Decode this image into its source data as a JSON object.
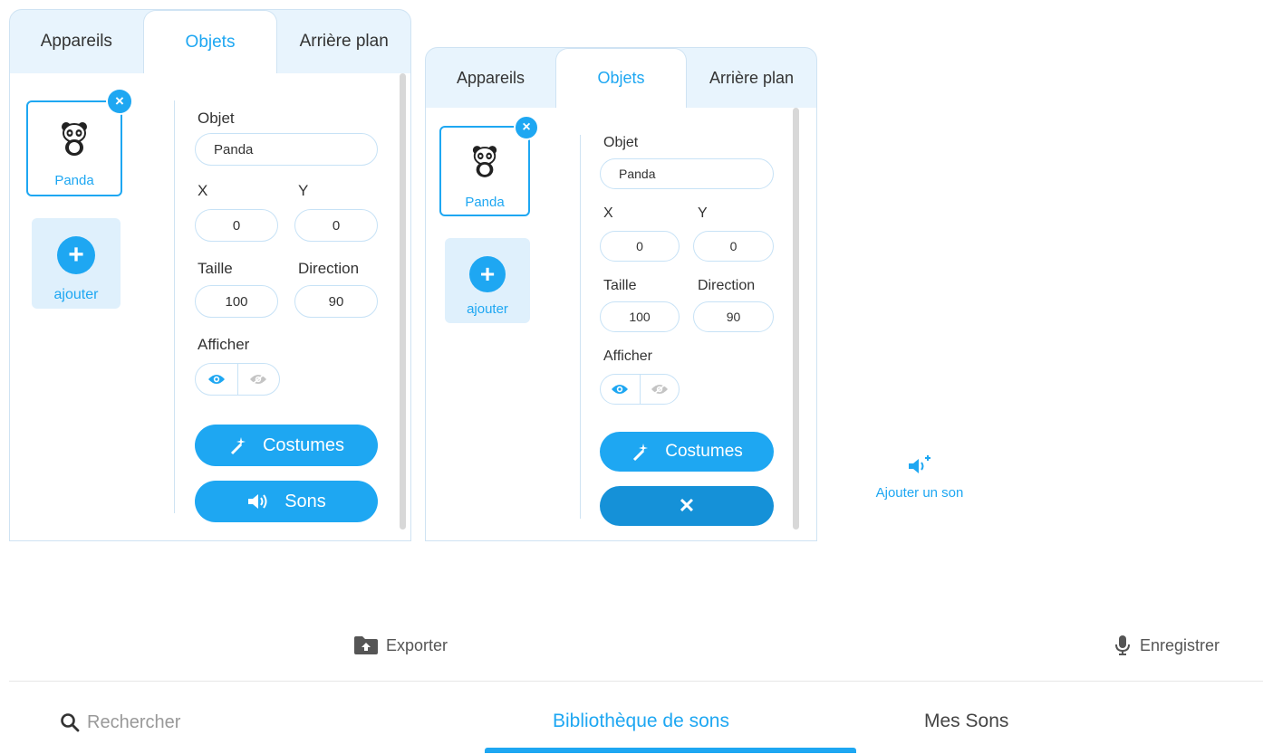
{
  "tabs": [
    "Appareils",
    "Objets",
    "Arrière plan"
  ],
  "sprite": {
    "name": "Panda",
    "close_label": "×"
  },
  "add_label": "ajouter",
  "add_plus": "+",
  "props": {
    "object_label": "Objet",
    "object_value": "Panda",
    "x_label": "X",
    "x_value": "0",
    "y_label": "Y",
    "y_value": "0",
    "size_label": "Taille",
    "size_value": "100",
    "direction_label": "Direction",
    "direction_value": "90",
    "show_label": "Afficher"
  },
  "buttons": {
    "costumes": "Costumes",
    "sounds": "Sons",
    "close_x": "✕"
  },
  "sound_panel": {
    "add_sound": "Ajouter un son"
  },
  "actions": {
    "export": "Exporter",
    "record": "Enregistrer"
  },
  "library": {
    "search_placeholder": "Rechercher",
    "tab_library": "Bibliothèque de sons",
    "tab_mine": "Mes Sons"
  },
  "colors": {
    "accent": "#1ea7f2",
    "panel_bg": "#e8f4fd",
    "border": "#c7e2f6"
  }
}
